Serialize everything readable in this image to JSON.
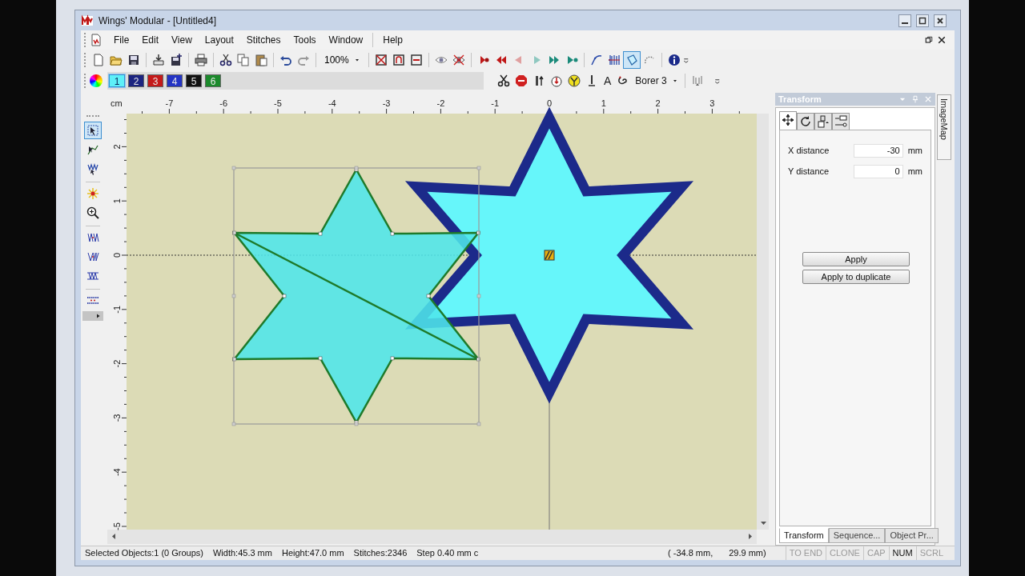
{
  "window": {
    "title": "Wings' Modular - [Untitled4]"
  },
  "menu": [
    "File",
    "Edit",
    "View",
    "Layout",
    "Stitches",
    "Tools",
    "Window",
    "Help"
  ],
  "toolbar_1": {
    "zoom": "100%",
    "drawing_tools": [
      {
        "selected": false
      },
      {
        "selected": false
      },
      {
        "selected": true
      },
      {
        "selected": false
      }
    ]
  },
  "toolbar_2": {
    "swatches": [
      {
        "label": "1",
        "color": "#5ef0f8",
        "selected": true
      },
      {
        "label": "2",
        "color": "#1c2480",
        "selected": false
      },
      {
        "label": "3",
        "color": "#c41a1a",
        "selected": false
      },
      {
        "label": "4",
        "color": "#2434c4",
        "selected": false
      },
      {
        "label": "5",
        "color": "#121212",
        "selected": false
      },
      {
        "label": "6",
        "color": "#1c8a2c",
        "selected": false
      }
    ],
    "text_tool": "A",
    "machine": "Borer 3"
  },
  "left_toolbar": {
    "tools": [
      {
        "selected": true
      },
      {
        "selected": false
      },
      {
        "selected": false
      }
    ]
  },
  "rulers": {
    "unit": "cm",
    "x_labels": [
      "-7",
      "-6",
      "-5",
      "-4",
      "-3",
      "-2",
      "-1",
      "0",
      "1",
      "2",
      "3"
    ],
    "y_labels": [
      "2",
      "1",
      "0",
      "-1",
      "-2",
      "-3",
      "-4",
      "-5"
    ]
  },
  "transform_panel": {
    "title": "Transform",
    "tabs": [
      {
        "selected": true
      },
      {
        "selected": false
      },
      {
        "selected": false
      },
      {
        "selected": false
      }
    ],
    "fields": [
      {
        "label": "X distance",
        "value": "-30",
        "unit": "mm"
      },
      {
        "label": "Y distance",
        "value": "0",
        "unit": "mm"
      }
    ],
    "buttons": [
      "Apply",
      "Apply to duplicate"
    ]
  },
  "side_tab": "ImageMap",
  "panel_tabs": [
    {
      "label": "Transform",
      "selected": true
    },
    {
      "label": "Sequence...",
      "selected": false
    },
    {
      "label": "Object Pr...",
      "selected": false
    }
  ],
  "status_bar": {
    "items": [
      "Selected Objects:1 (0 Groups)",
      "Width:45.3 mm",
      "Height:47.0 mm",
      "Stitches:2346",
      "Step 0.40 mm c"
    ],
    "coordinates": [
      "( -34.8 mm,",
      "29.9 mm)"
    ],
    "indicators": [
      {
        "label": "TO END",
        "on": false
      },
      {
        "label": "CLONE",
        "on": false
      },
      {
        "label": "CAP",
        "on": false
      },
      {
        "label": "NUM",
        "on": true
      },
      {
        "label": "SCRL",
        "on": false
      }
    ]
  }
}
